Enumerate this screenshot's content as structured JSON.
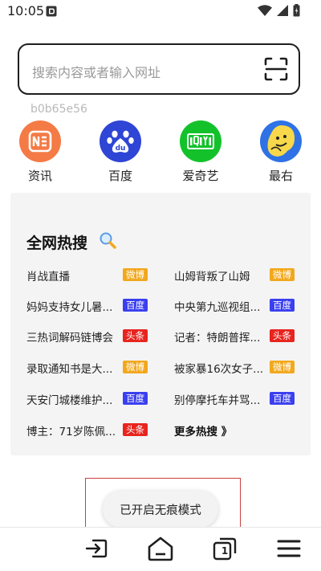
{
  "status": {
    "time": "10:05"
  },
  "search": {
    "placeholder": "搜索内容或者输入网址"
  },
  "hash_text": "b0b65e56",
  "shortcuts": [
    {
      "label": "资讯",
      "icon": "news-icon",
      "color": "#f47b46"
    },
    {
      "label": "百度",
      "icon": "baidu-paw-icon",
      "color": "#2f45d6"
    },
    {
      "label": "爱奇艺",
      "icon": "iqiyi-icon",
      "color": "#13c22b"
    },
    {
      "label": "最右",
      "icon": "zuiyou-icon",
      "color": "#2e72e6"
    }
  ],
  "hot": {
    "title": "全网热搜",
    "items": [
      {
        "text": "肖战直播",
        "source": "微博"
      },
      {
        "text": "山姆背叛了山姆",
        "source": "微博"
      },
      {
        "text": "妈妈支持女儿暑...",
        "source": "百度"
      },
      {
        "text": "中央第九巡视组...",
        "source": "百度"
      },
      {
        "text": "三热词解码链博会",
        "source": "头条"
      },
      {
        "text": "记者：特朗普挥...",
        "source": "头条"
      },
      {
        "text": "录取通知书是大...",
        "source": "微博"
      },
      {
        "text": "被家暴16次女子...",
        "source": "微博"
      },
      {
        "text": "天安门城楼维护...",
        "source": "百度"
      },
      {
        "text": "别停摩托车并骂...",
        "source": "百度"
      },
      {
        "text": "博主：71岁陈佩...",
        "source": "头条"
      }
    ],
    "more": "更多热搜 》"
  },
  "toast": "已开启无痕模式",
  "bottom": {
    "tab_count": "1"
  },
  "colors": {
    "weibo": "#f2a81d",
    "baidu": "#3a3ff0",
    "toutiao": "#e8241e"
  }
}
